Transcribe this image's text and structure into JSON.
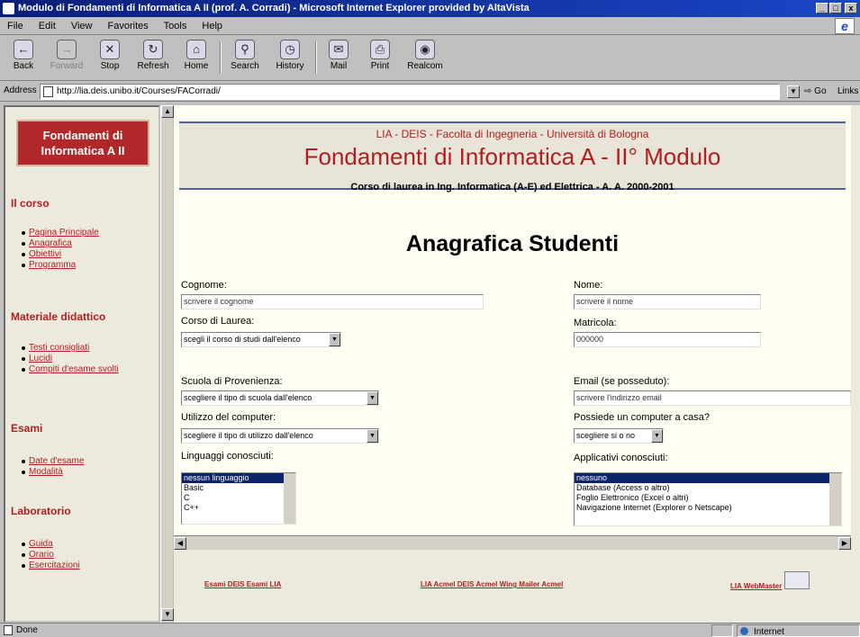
{
  "window": {
    "title": "Modulo di Fondamenti di Informatica A II (prof. A. Corradi) - Microsoft Internet Explorer provided by AltaVista"
  },
  "menu": [
    "File",
    "Edit",
    "View",
    "Favorites",
    "Tools",
    "Help"
  ],
  "toolbar": {
    "back": "Back",
    "forward": "Forward",
    "stop": "Stop",
    "refresh": "Refresh",
    "home": "Home",
    "search": "Search",
    "history": "History",
    "mail": "Mail",
    "print": "Print",
    "realcom": "Realcom"
  },
  "address": {
    "label": "Address",
    "url": "http://lia.deis.unibo.it/Courses/FACorradi/",
    "go": "Go",
    "links": "Links"
  },
  "sidebar": {
    "title": "Fondamenti di Informatica A II",
    "sections": [
      {
        "heading": "Il corso",
        "items": [
          "Pagina Principale",
          "Anagrafica",
          "Obiettivi",
          "Programma"
        ]
      },
      {
        "heading": "Materiale didattico",
        "items": [
          "Testi consigliati",
          "Lucidi",
          "Compiti d'esame svolti"
        ]
      },
      {
        "heading": "Esami",
        "items": [
          "Date d'esame",
          "Modalità"
        ]
      },
      {
        "heading": "Laboratorio",
        "items": [
          "Guida",
          "Orario",
          "Esercitazioni"
        ]
      }
    ]
  },
  "header": {
    "university": "LIA - DEIS - Facolta di Ingegneria - Università di Bologna",
    "course": "Fondamenti di Informatica A - II° Modulo",
    "subtitle": "Corso di laurea in Ing. Informatica (A-E) ed Elettrica - A. A. 2000-2001"
  },
  "form": {
    "title": "Anagrafica Studenti",
    "cognome": {
      "label": "Cognome:",
      "value": "scrivere il cognome"
    },
    "nome": {
      "label": "Nome:",
      "value": "scrivere il nome"
    },
    "corso": {
      "label": "Corso di Laurea:",
      "value": "scegli il corso di studi dall'elenco"
    },
    "matricola": {
      "label": "Matricola:",
      "value": "000000"
    },
    "scuola": {
      "label": "Scuola di Provenienza:",
      "value": "scegliere il tipo di scuola dall'elenco"
    },
    "email": {
      "label": "Email (se posseduto):",
      "value": "scrivere l'indirizzo email"
    },
    "utilizzo": {
      "label": "Utilizzo del computer:",
      "value": "scegliere il tipo di utilizzo dall'elenco"
    },
    "computer_casa": {
      "label": "Possiede un computer a casa?",
      "value": "scegliere si o no"
    },
    "linguaggi": {
      "label": "Linguaggi conosciuti:",
      "options": [
        "nessun linguaggio",
        "Basic",
        "C",
        "C++"
      ]
    },
    "applicativi": {
      "label": "Applicativi conosciuti:",
      "options": [
        "nessuno",
        "Database (Access o altro)",
        "Foglio Elettronico (Excel o altri)",
        "Navigazione Internet (Explorer o Netscape)"
      ]
    }
  },
  "footer": {
    "link1": "Esami DEIS Esami LIA",
    "link2": "LIA Acmel DEIS Acmel Wing Mailer Acmel",
    "webmaster": "LIA WebMaster"
  },
  "status": {
    "text": "Done",
    "zone": "Internet"
  }
}
